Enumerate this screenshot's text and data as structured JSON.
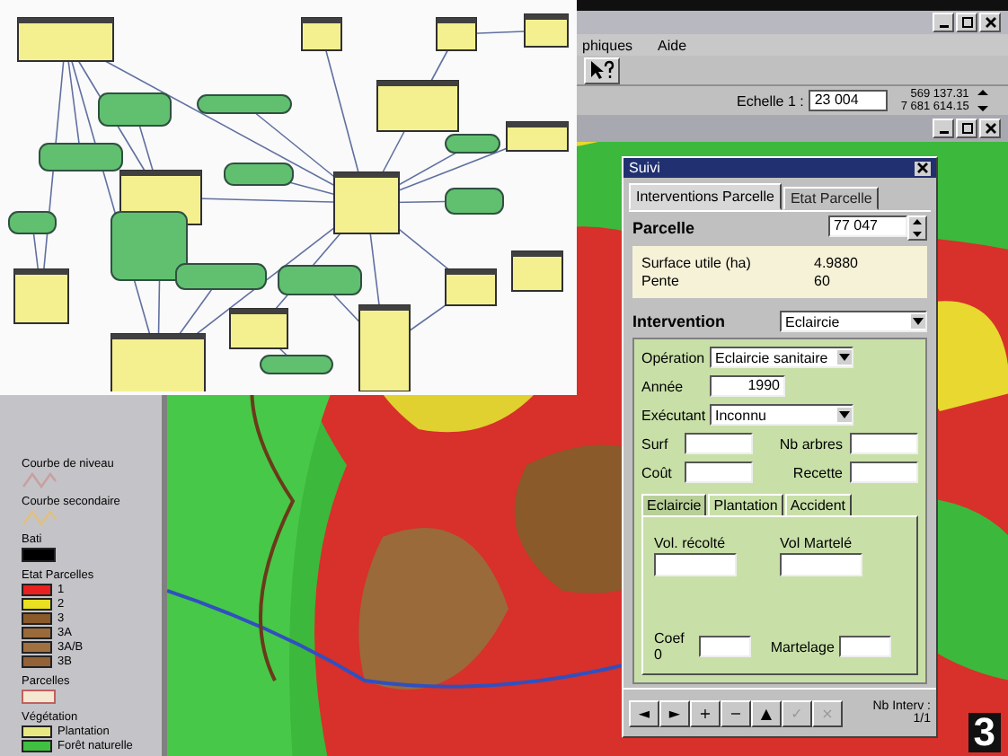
{
  "menu": [
    "phiques",
    "Aide"
  ],
  "status": {
    "scale_label": "Echelle 1 :",
    "scale_value": "23 004",
    "coords": [
      "569 137.31",
      "7 681 614.15"
    ]
  },
  "legend": [
    {
      "title": "Courbe de niveau",
      "kind": "line",
      "color": "#c8a0a0"
    },
    {
      "title": "Courbe secondaire",
      "kind": "line",
      "color": "#e0c080"
    },
    {
      "title": "Bati",
      "kind": "fill",
      "color": "#000000"
    },
    {
      "title": "Etat Parcelles",
      "kind": "classes",
      "classes": [
        {
          "label": "1",
          "color": "#e82020"
        },
        {
          "label": "2",
          "color": "#e8e020"
        },
        {
          "label": "3",
          "color": "#8a5a2a"
        },
        {
          "label": "3A",
          "color": "#9a6a3a"
        },
        {
          "label": "3A/B",
          "color": "#a07040"
        },
        {
          "label": "3B",
          "color": "#946236"
        }
      ]
    },
    {
      "title": "Parcelles",
      "kind": "outline",
      "color": "#f4e8d0"
    },
    {
      "title": "Végétation",
      "kind": "classes",
      "classes": [
        {
          "label": "Plantation",
          "color": "#e8e880"
        },
        {
          "label": "Forêt naturelle",
          "color": "#40c040"
        }
      ]
    }
  ],
  "dialog": {
    "title": "Suivi",
    "tabs": [
      {
        "label": "Interventions Parcelle",
        "selected": true
      },
      {
        "label": "Etat Parcelle",
        "selected": false
      }
    ],
    "parcelle_label": "Parcelle",
    "parcelle_value": "77 047",
    "info": [
      {
        "label": "Surface utile (ha)",
        "value": "4.9880"
      },
      {
        "label": "Pente",
        "value": "60"
      }
    ],
    "intervention_label": "Intervention",
    "intervention_value": "Eclaircie",
    "fields": [
      {
        "label": "Opération",
        "kind": "dropdown",
        "value": "Eclaircie sanitaire"
      },
      {
        "label": "Année",
        "kind": "input",
        "value": "1990"
      },
      {
        "label": "Exécutant",
        "kind": "dropdown",
        "value": "Inconnu"
      }
    ],
    "pairs": [
      {
        "label": "Surf",
        "label_2": "Nb arbres"
      },
      {
        "label": "Coût",
        "label_2": "Recette"
      }
    ],
    "subtabs": [
      {
        "label": "Eclaircie",
        "selected": true
      },
      {
        "label": "Plantation",
        "selected": false
      },
      {
        "label": "Accident",
        "selected": false
      }
    ],
    "volumes": [
      "Vol. récolté",
      "Vol Martelé"
    ],
    "bottom_fields": [
      "Coef 0",
      "Martelage"
    ],
    "nav": [
      {
        "label": "◄",
        "disabled": false
      },
      {
        "label": "►",
        "disabled": false
      },
      {
        "label": "+",
        "disabled": false
      },
      {
        "label": "−",
        "disabled": false
      },
      {
        "label": "▲",
        "disabled": false
      },
      {
        "label": "✓",
        "disabled": true
      },
      {
        "label": "×",
        "disabled": true
      }
    ],
    "count_label": "Nb Interv :",
    "count": "1/1"
  },
  "figure_number": "3"
}
